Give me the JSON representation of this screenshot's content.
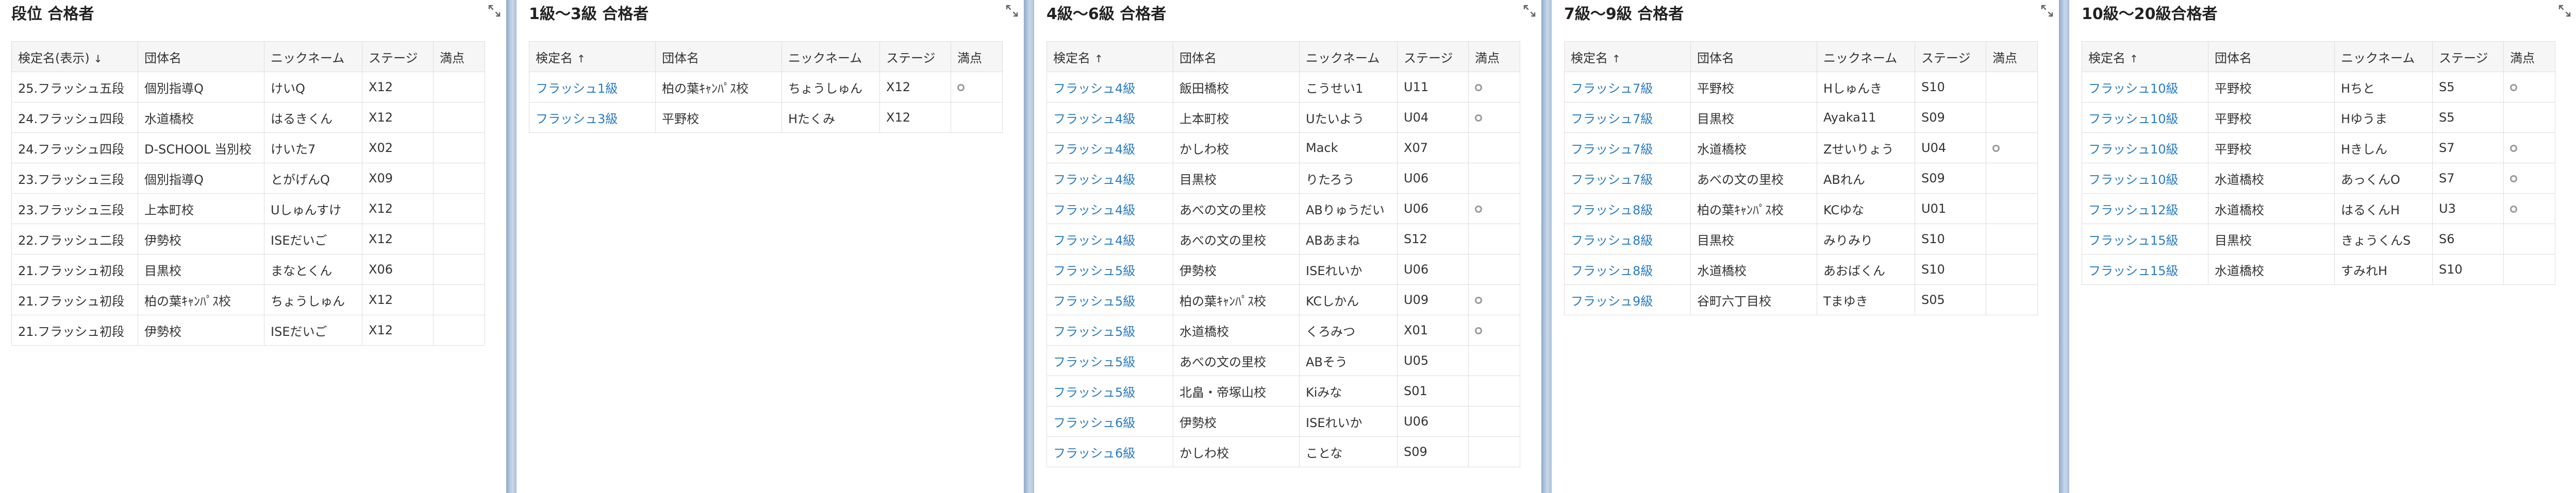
{
  "headers": {
    "name": "検定名",
    "name_display": "検定名(表示)",
    "school": "団体名",
    "nickname": "ニックネーム",
    "stage": "ステージ",
    "perfect": "満点"
  },
  "panels": [
    {
      "title": "段位 合格者",
      "sort": "↓",
      "linkNames": false,
      "rows": [
        {
          "name": "25.フラッシュ五段",
          "school": "個別指導Q",
          "nick": "けいQ",
          "stage": "X12",
          "perfect": false
        },
        {
          "name": "24.フラッシュ四段",
          "school": "水道橋校",
          "nick": "はるきくん",
          "stage": "X12",
          "perfect": false
        },
        {
          "name": "24.フラッシュ四段",
          "school": "D-SCHOOL 当別校",
          "nick": "けいた7",
          "stage": "X02",
          "perfect": false
        },
        {
          "name": "23.フラッシュ三段",
          "school": "個別指導Q",
          "nick": "とがげんQ",
          "stage": "X09",
          "perfect": false
        },
        {
          "name": "23.フラッシュ三段",
          "school": "上本町校",
          "nick": "Uしゅんすけ",
          "stage": "X12",
          "perfect": false
        },
        {
          "name": "22.フラッシュ二段",
          "school": "伊勢校",
          "nick": "ISEだいご",
          "stage": "X12",
          "perfect": false
        },
        {
          "name": "21.フラッシュ初段",
          "school": "目黒校",
          "nick": "まなとくん",
          "stage": "X06",
          "perfect": false
        },
        {
          "name": "21.フラッシュ初段",
          "school": "柏の葉ｷｬﾝﾊﾟｽ校",
          "nick": "ちょうしゅん",
          "stage": "X12",
          "perfect": false
        },
        {
          "name": "21.フラッシュ初段",
          "school": "伊勢校",
          "nick": "ISEだいご",
          "stage": "X12",
          "perfect": false
        }
      ]
    },
    {
      "title": "1級～3級 合格者",
      "sort": "↑",
      "linkNames": true,
      "rows": [
        {
          "name": "フラッシュ1級",
          "school": "柏の葉ｷｬﾝﾊﾟｽ校",
          "nick": "ちょうしゅん",
          "stage": "X12",
          "perfect": true
        },
        {
          "name": "フラッシュ3級",
          "school": "平野校",
          "nick": "Hたくみ",
          "stage": "X12",
          "perfect": false
        }
      ]
    },
    {
      "title": "4級～6級 合格者",
      "sort": "↑",
      "linkNames": true,
      "rows": [
        {
          "name": "フラッシュ4級",
          "school": "飯田橋校",
          "nick": "こうせい1",
          "stage": "U11",
          "perfect": true
        },
        {
          "name": "フラッシュ4級",
          "school": "上本町校",
          "nick": "Uたいよう",
          "stage": "U04",
          "perfect": true
        },
        {
          "name": "フラッシュ4級",
          "school": "かしわ校",
          "nick": "Mack",
          "stage": "X07",
          "perfect": false
        },
        {
          "name": "フラッシュ4級",
          "school": "目黒校",
          "nick": "りたろう",
          "stage": "U06",
          "perfect": false
        },
        {
          "name": "フラッシュ4級",
          "school": "あべの文の里校",
          "nick": "ABりゅうだい",
          "stage": "U06",
          "perfect": true
        },
        {
          "name": "フラッシュ4級",
          "school": "あべの文の里校",
          "nick": "ABあまね",
          "stage": "S12",
          "perfect": false
        },
        {
          "name": "フラッシュ5級",
          "school": "伊勢校",
          "nick": "ISEれいか",
          "stage": "U06",
          "perfect": false
        },
        {
          "name": "フラッシュ5級",
          "school": "柏の葉ｷｬﾝﾊﾟｽ校",
          "nick": "KCしかん",
          "stage": "U09",
          "perfect": true
        },
        {
          "name": "フラッシュ5級",
          "school": "水道橋校",
          "nick": "くろみつ",
          "stage": "X01",
          "perfect": true
        },
        {
          "name": "フラッシュ5級",
          "school": "あべの文の里校",
          "nick": "ABそう",
          "stage": "U05",
          "perfect": false
        },
        {
          "name": "フラッシュ5級",
          "school": "北畠・帝塚山校",
          "nick": "Kiみな",
          "stage": "S01",
          "perfect": false
        },
        {
          "name": "フラッシュ6級",
          "school": "伊勢校",
          "nick": "ISEれいか",
          "stage": "U06",
          "perfect": false
        },
        {
          "name": "フラッシュ6級",
          "school": "かしわ校",
          "nick": "ことな",
          "stage": "S09",
          "perfect": false
        }
      ]
    },
    {
      "title": "7級～9級 合格者",
      "sort": "↑",
      "linkNames": true,
      "rows": [
        {
          "name": "フラッシュ7級",
          "school": "平野校",
          "nick": "Hしゅんき",
          "stage": "S10",
          "perfect": false
        },
        {
          "name": "フラッシュ7級",
          "school": "目黒校",
          "nick": "Ayaka11",
          "stage": "S09",
          "perfect": false
        },
        {
          "name": "フラッシュ7級",
          "school": "水道橋校",
          "nick": "Zせいりょう",
          "stage": "U04",
          "perfect": true
        },
        {
          "name": "フラッシュ7級",
          "school": "あべの文の里校",
          "nick": "ABれん",
          "stage": "S09",
          "perfect": false
        },
        {
          "name": "フラッシュ8級",
          "school": "柏の葉ｷｬﾝﾊﾟｽ校",
          "nick": "KCゆな",
          "stage": "U01",
          "perfect": false
        },
        {
          "name": "フラッシュ8級",
          "school": "目黒校",
          "nick": "みりみり",
          "stage": "S10",
          "perfect": false
        },
        {
          "name": "フラッシュ8級",
          "school": "水道橋校",
          "nick": "あおばくん",
          "stage": "S10",
          "perfect": false
        },
        {
          "name": "フラッシュ9級",
          "school": "谷町六丁目校",
          "nick": "Tまゆき",
          "stage": "S05",
          "perfect": false
        }
      ]
    },
    {
      "title": "10級～20級合格者",
      "sort": "↑",
      "linkNames": true,
      "rows": [
        {
          "name": "フラッシュ10級",
          "school": "平野校",
          "nick": "Hちと",
          "stage": "S5",
          "perfect": true
        },
        {
          "name": "フラッシュ10級",
          "school": "平野校",
          "nick": "Hゆうま",
          "stage": "S5",
          "perfect": false
        },
        {
          "name": "フラッシュ10級",
          "school": "平野校",
          "nick": "Hきしん",
          "stage": "S7",
          "perfect": true
        },
        {
          "name": "フラッシュ10級",
          "school": "水道橋校",
          "nick": "あっくんO",
          "stage": "S7",
          "perfect": true
        },
        {
          "name": "フラッシュ12級",
          "school": "水道橋校",
          "nick": "はるくんH",
          "stage": "U3",
          "perfect": true
        },
        {
          "name": "フラッシュ15級",
          "school": "目黒校",
          "nick": "きょうくんS",
          "stage": "S6",
          "perfect": false
        },
        {
          "name": "フラッシュ15級",
          "school": "水道橋校",
          "nick": "すみれH",
          "stage": "S10",
          "perfect": false
        }
      ]
    }
  ],
  "icons": {
    "expand": "expand-icon",
    "perfect": "circle-mark-icon",
    "sort": "sort-arrow-icon"
  },
  "colors": {
    "link": "#2a7cc2",
    "divider": "#a9bfd9",
    "header_bg": "#f6f6f6",
    "border": "#dddddd"
  }
}
